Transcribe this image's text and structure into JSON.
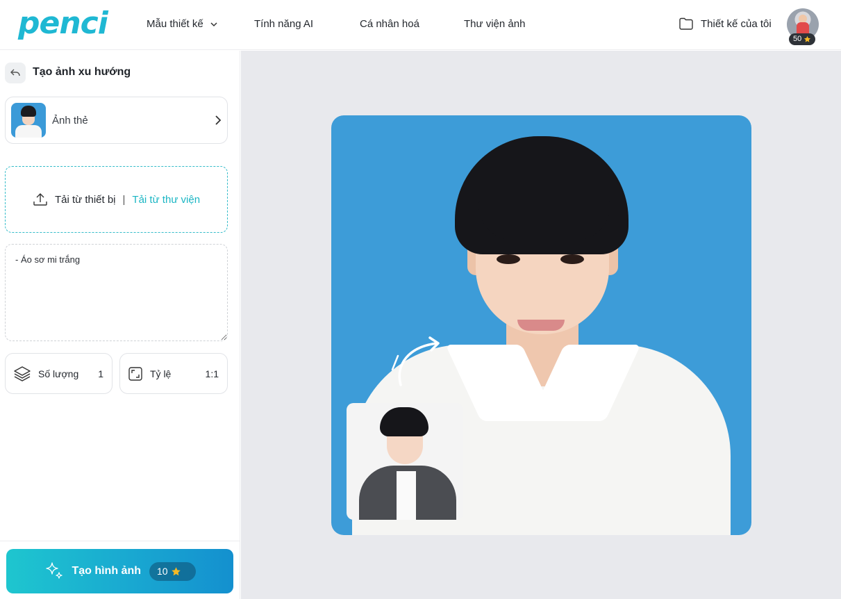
{
  "header": {
    "logo": "penci",
    "nav": [
      {
        "label": "Mẫu thiết kế",
        "has_dropdown": true
      },
      {
        "label": "Tính năng AI"
      },
      {
        "label": "Cá nhân hoá"
      },
      {
        "label": "Thư viện ảnh"
      }
    ],
    "my_designs": "Thiết kế của tôi",
    "star_balance": "50"
  },
  "sidebar": {
    "title": "Tạo ảnh xu hướng",
    "style_card": {
      "label": "Ảnh thẻ"
    },
    "upload": {
      "device_label": "Tải từ thiết bị",
      "separator": "|",
      "library_label": "Tải từ thư viện"
    },
    "prompt_text": "- Áo sơ mi trắng",
    "quantity": {
      "label": "Số lượng",
      "value": "1"
    },
    "ratio": {
      "label": "Tỷ lệ",
      "value": "1:1"
    },
    "generate": {
      "label": "Tạo hình ảnh",
      "cost": "10"
    }
  },
  "colors": {
    "accent": "#1bb6c4",
    "preview_background": "#3d9cd8",
    "canvas_background": "#e8e9ed"
  },
  "icons": [
    "chevron-down-icon",
    "folder-icon",
    "star-icon",
    "back-icon",
    "chevron-right-icon",
    "upload-icon",
    "layers-icon",
    "aspect-ratio-icon",
    "sparkles-icon",
    "curved-arrow-icon"
  ]
}
